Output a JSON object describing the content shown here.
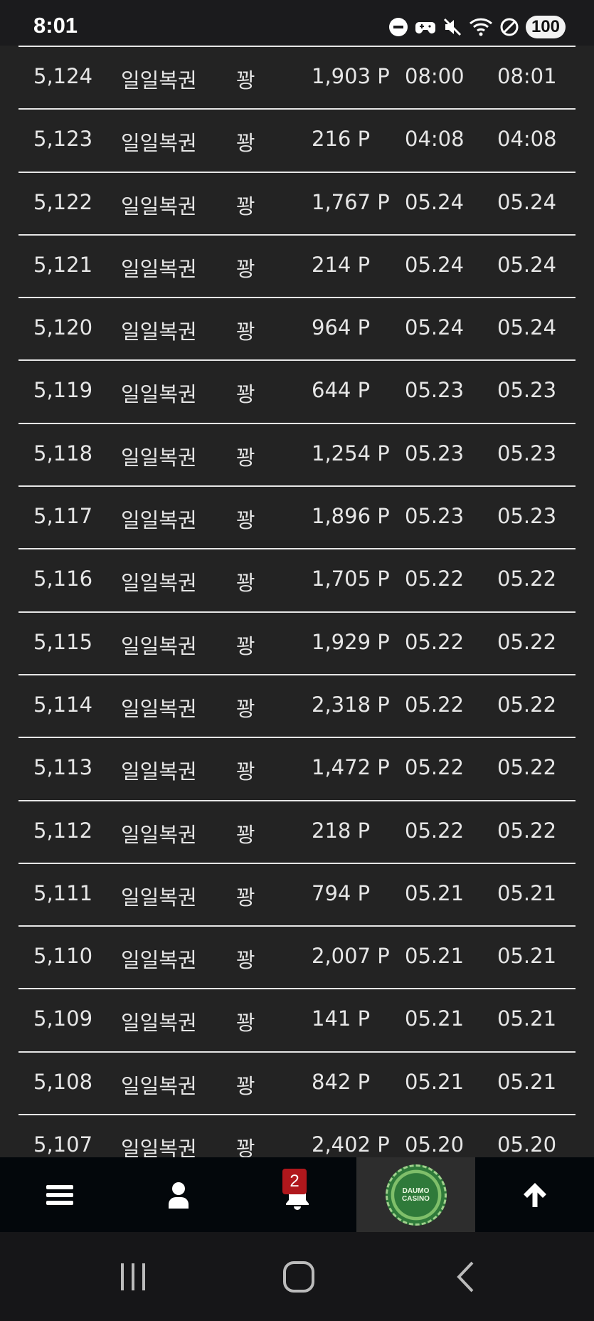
{
  "status_bar": {
    "time": "8:01",
    "battery": "100",
    "icons": [
      "dnd-icon",
      "game-controller-icon",
      "mute-icon",
      "wifi-icon",
      "blocked-icon",
      "battery-icon"
    ]
  },
  "rows": [
    {
      "no": "5,124",
      "name": "일일복권",
      "user": "꽝",
      "points": "1,903 P",
      "date1": "08:00",
      "date2": "08:01"
    },
    {
      "no": "5,123",
      "name": "일일복권",
      "user": "꽝",
      "points": "216 P",
      "date1": "04:08",
      "date2": "04:08"
    },
    {
      "no": "5,122",
      "name": "일일복권",
      "user": "꽝",
      "points": "1,767 P",
      "date1": "05.24",
      "date2": "05.24"
    },
    {
      "no": "5,121",
      "name": "일일복권",
      "user": "꽝",
      "points": "214 P",
      "date1": "05.24",
      "date2": "05.24"
    },
    {
      "no": "5,120",
      "name": "일일복권",
      "user": "꽝",
      "points": "964 P",
      "date1": "05.24",
      "date2": "05.24"
    },
    {
      "no": "5,119",
      "name": "일일복권",
      "user": "꽝",
      "points": "644 P",
      "date1": "05.23",
      "date2": "05.23"
    },
    {
      "no": "5,118",
      "name": "일일복권",
      "user": "꽝",
      "points": "1,254 P",
      "date1": "05.23",
      "date2": "05.23"
    },
    {
      "no": "5,117",
      "name": "일일복권",
      "user": "꽝",
      "points": "1,896 P",
      "date1": "05.23",
      "date2": "05.23"
    },
    {
      "no": "5,116",
      "name": "일일복권",
      "user": "꽝",
      "points": "1,705 P",
      "date1": "05.22",
      "date2": "05.22"
    },
    {
      "no": "5,115",
      "name": "일일복권",
      "user": "꽝",
      "points": "1,929 P",
      "date1": "05.22",
      "date2": "05.22"
    },
    {
      "no": "5,114",
      "name": "일일복권",
      "user": "꽝",
      "points": "2,318 P",
      "date1": "05.22",
      "date2": "05.22"
    },
    {
      "no": "5,113",
      "name": "일일복권",
      "user": "꽝",
      "points": "1,472 P",
      "date1": "05.22",
      "date2": "05.22"
    },
    {
      "no": "5,112",
      "name": "일일복권",
      "user": "꽝",
      "points": "218 P",
      "date1": "05.22",
      "date2": "05.22"
    },
    {
      "no": "5,111",
      "name": "일일복권",
      "user": "꽝",
      "points": "794 P",
      "date1": "05.21",
      "date2": "05.21"
    },
    {
      "no": "5,110",
      "name": "일일복권",
      "user": "꽝",
      "points": "2,007 P",
      "date1": "05.21",
      "date2": "05.21"
    },
    {
      "no": "5,109",
      "name": "일일복권",
      "user": "꽝",
      "points": "141 P",
      "date1": "05.21",
      "date2": "05.21"
    },
    {
      "no": "5,108",
      "name": "일일복권",
      "user": "꽝",
      "points": "842 P",
      "date1": "05.21",
      "date2": "05.21"
    },
    {
      "no": "5,107",
      "name": "일일복권",
      "user": "꽝",
      "points": "2,402 P",
      "date1": "05.20",
      "date2": "05.20"
    }
  ],
  "bottom_nav": {
    "notification_count": "2",
    "logo_line1": "DAUMO",
    "logo_line2": "CASINO",
    "items": [
      "menu-icon",
      "user-icon",
      "bell-icon",
      "casino-logo",
      "arrow-up-icon"
    ]
  },
  "colors": {
    "background": "#232323",
    "divider": "#e6e6e6",
    "nav_background": "#03070b",
    "badge": "#b0171c"
  }
}
